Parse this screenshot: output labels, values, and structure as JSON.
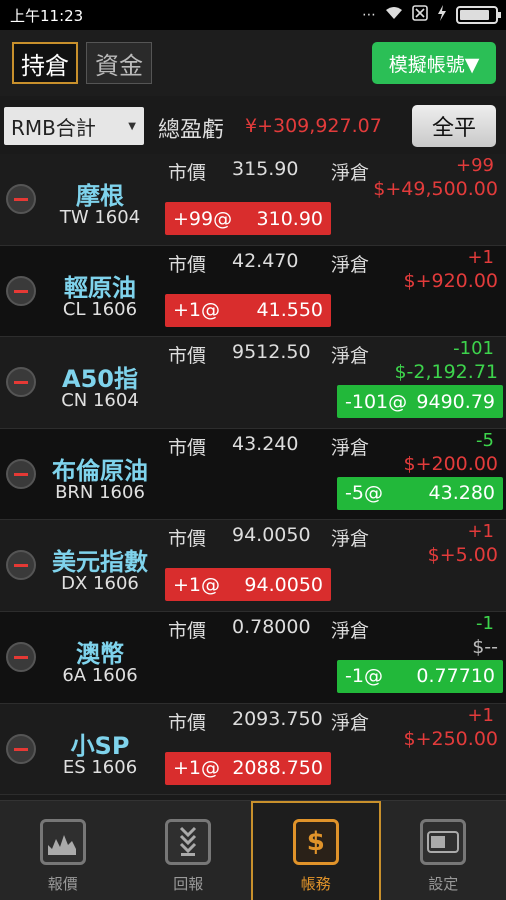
{
  "status_bar": {
    "time": "上午11:23",
    "icons": [
      "more-dots-icon",
      "wifi-icon",
      "no-sim-icon",
      "charging-icon",
      "battery-icon"
    ],
    "battery_level": 0.85
  },
  "tabs": [
    {
      "label": "持倉",
      "active": true
    },
    {
      "label": "資金",
      "active": false
    }
  ],
  "sim_account_button": "模擬帳號▼",
  "summary": {
    "currency": "RMB合計",
    "label": "總盈虧",
    "value": "¥+309,927.07",
    "close_all": "全平"
  },
  "labels": {
    "market_price": "市價",
    "net_position": "淨倉"
  },
  "positions": [
    {
      "name": "摩根",
      "code": "TW 1604",
      "price": "315.90",
      "qty": "+99",
      "pnl": "$+49,500.00",
      "fill_qty": "+99@",
      "fill_price": "310.90",
      "direction": "long"
    },
    {
      "name": "輕原油",
      "code": "CL 1606",
      "price": "42.470",
      "qty": "+1",
      "pnl": "$+920.00",
      "fill_qty": "+1@",
      "fill_price": "41.550",
      "direction": "long"
    },
    {
      "name": "A50指",
      "code": "CN 1604",
      "price": "9512.50",
      "qty": "-101",
      "pnl": "$-2,192.71",
      "fill_qty": "-101@",
      "fill_price": "9490.79",
      "direction": "short"
    },
    {
      "name": "布倫原油",
      "code": "BRN 1606",
      "price": "43.240",
      "qty": "-5",
      "pnl": "$+200.00",
      "fill_qty": "-5@",
      "fill_price": "43.280",
      "direction": "short"
    },
    {
      "name": "美元指數",
      "code": "DX 1606",
      "price": "94.0050",
      "qty": "+1",
      "pnl": "$+5.00",
      "fill_qty": "+1@",
      "fill_price": "94.0050",
      "direction": "long"
    },
    {
      "name": "澳幣",
      "code": "6A 1606",
      "price": "0.78000",
      "qty": "-1",
      "pnl": "$--",
      "fill_qty": "-1@",
      "fill_price": "0.77710",
      "direction": "short"
    },
    {
      "name": "小SP",
      "code": "ES 1606",
      "price": "2093.750",
      "qty": "+1",
      "pnl": "$+250.00",
      "fill_qty": "+1@",
      "fill_price": "2088.750",
      "direction": "long"
    }
  ],
  "bottom_nav": [
    {
      "label": "報價",
      "icon": "chart-icon",
      "active": false
    },
    {
      "label": "回報",
      "icon": "report-icon",
      "active": false
    },
    {
      "label": "帳務",
      "icon": "dollar-icon",
      "active": true
    },
    {
      "label": "設定",
      "icon": "settings-icon",
      "active": false
    }
  ],
  "colors": {
    "profit": "#e23b3b",
    "loss": "#3dd44c",
    "accent": "#c8902c",
    "name": "#7fd3ec",
    "sim_button": "#2bbf56"
  }
}
